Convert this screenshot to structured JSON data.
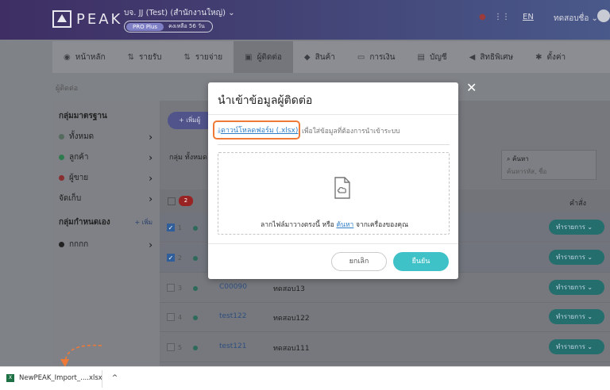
{
  "header": {
    "logo_text": "PEAK",
    "company": "บจ. JJ (Test) (สำนักงานใหญ่)",
    "plan": "PRO Plus",
    "remaining": "คงเหลือ 56 วัน",
    "lang": "EN",
    "user": "ทดสอบชื่อ"
  },
  "nav": [
    {
      "label": "หน้าหลัก",
      "icon": "dashboard-icon",
      "glyph": "◉"
    },
    {
      "label": "รายรับ",
      "icon": "income-icon",
      "glyph": "⇅"
    },
    {
      "label": "รายจ่าย",
      "icon": "expense-icon",
      "glyph": "⇅"
    },
    {
      "label": "ผู้ติดต่อ",
      "icon": "contact-icon",
      "glyph": "▣"
    },
    {
      "label": "สินค้า",
      "icon": "product-icon",
      "glyph": "◆"
    },
    {
      "label": "การเงิน",
      "icon": "finance-icon",
      "glyph": "▭"
    },
    {
      "label": "บัญชี",
      "icon": "account-icon",
      "glyph": "▤"
    },
    {
      "label": "สิทธิพิเศษ",
      "icon": "privilege-icon",
      "glyph": "◀"
    },
    {
      "label": "ตั้งค่า",
      "icon": "settings-icon",
      "glyph": "✱"
    }
  ],
  "breadcrumb": "ผู้ติดต่อ",
  "sidebar": {
    "standard_title": "กลุ่มมาตรฐาน",
    "items": [
      {
        "label": "ทั้งหมด",
        "color": "#556b5e"
      },
      {
        "label": "ลูกค้า",
        "color": "#2f7a4e"
      },
      {
        "label": "ผู้ขาย",
        "color": "#8a2f2f"
      },
      {
        "label": "จัดเก็บ",
        "color": ""
      }
    ],
    "custom_title": "กลุ่มกำหนดเอง",
    "custom_add": "+ เพิ่ม",
    "custom_items": [
      {
        "label": "กกกก",
        "color": "#222"
      }
    ]
  },
  "main": {
    "add_button": "+ เพิ่มผู้",
    "group_label": "กลุ่ม ทั้งหมด",
    "search_label": "ค้นหา",
    "search_placeholder": "ค้นหารหัส, ชื่อ",
    "selected_count": "2",
    "action_header": "คำสั่ง",
    "rows": [
      {
        "num": "1",
        "code": "",
        "name": "",
        "checked": true,
        "action": "ทำรายการ"
      },
      {
        "num": "2",
        "code": "",
        "name": "",
        "checked": true,
        "action": "ทำรายการ"
      },
      {
        "num": "3",
        "code": "C00090",
        "name": "ทดสอบ13",
        "checked": false,
        "action": "ทำรายการ"
      },
      {
        "num": "4",
        "code": "test122",
        "name": "ทดสอบ122",
        "checked": false,
        "action": "ทำรายการ"
      },
      {
        "num": "5",
        "code": "test121",
        "name": "ทดสอบ111",
        "checked": false,
        "action": "ทำรายการ"
      }
    ]
  },
  "modal": {
    "title": "นำเข้าข้อมูลผู้ติดต่อ",
    "download_link": "ดาวน์โหลดฟอร์ม (.xlsx)",
    "download_hint": "เพื่อใส่ข้อมูลที่ต้องการนำเข้าระบบ",
    "drop_text_before": "ลากไฟล์มาวางตรงนี้ หรือ ",
    "drop_link": "ค้นหา",
    "drop_text_after": " จากเครื่องของคุณ",
    "cancel": "ยกเลิก",
    "confirm": "ยืนยัน",
    "close": "✕"
  },
  "download_bar": {
    "filename": "NewPEAK_Import_....xlsx",
    "chevron": "^"
  },
  "colors": {
    "accent": "#3ec2c7",
    "link": "#2f7fc8",
    "highlight": "#ef7a37"
  }
}
